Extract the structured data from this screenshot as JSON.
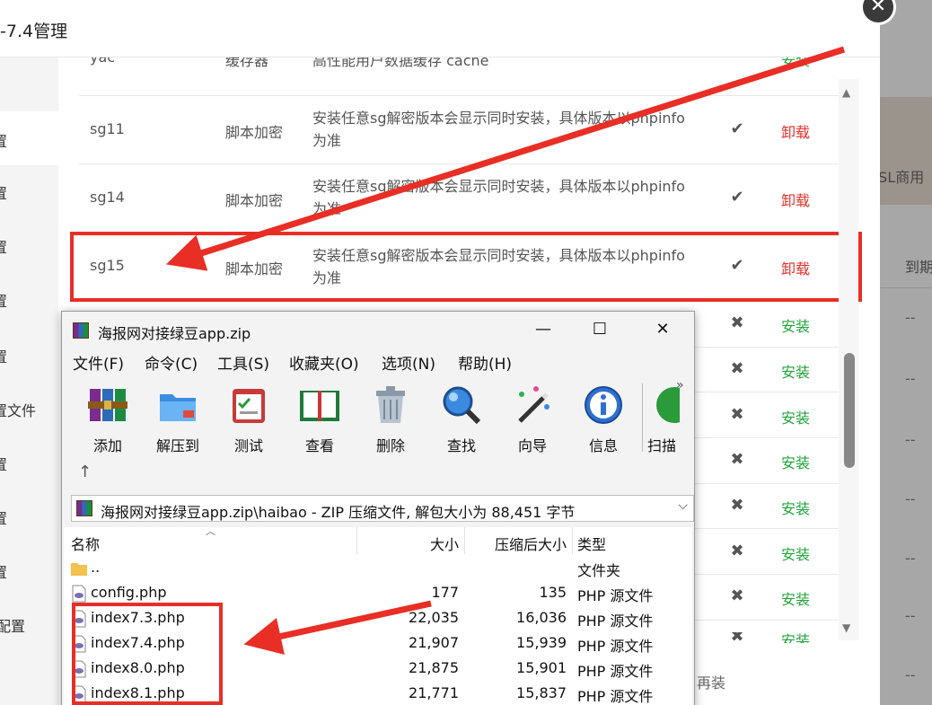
{
  "dialog": {
    "title": "-7.4管理",
    "sidebar": [
      {
        "label": "置"
      },
      {
        "label": "置"
      },
      {
        "label": "置"
      },
      {
        "label": "置"
      },
      {
        "label": "置"
      },
      {
        "label": "置文件"
      },
      {
        "label": "置"
      },
      {
        "label": "置"
      },
      {
        "label": "置"
      },
      {
        "label": "配置"
      }
    ],
    "top_partial_row": {
      "name": "yac",
      "type": "缓存器",
      "desc": "高性能用户数据缓存 cache",
      "action": "安装"
    },
    "rows": [
      {
        "name": "sg11",
        "type": "脚本加密",
        "desc": "安装任意sg解密版本会显示同时安装，具体版本以phpinfo为准",
        "status": "✔",
        "action": "卸载"
      },
      {
        "name": "sg14",
        "type": "脚本加密",
        "desc": "安装任意sg解密版本会显示同时安装，具体版本以phpinfo为准",
        "status": "✔",
        "action": "卸载"
      },
      {
        "name": "sg15",
        "type": "脚本加密",
        "desc": "安装任意sg解密版本会显示同时安装，具体版本以phpinfo为准",
        "status": "✔",
        "action": "卸载"
      }
    ],
    "install_rows": [
      {
        "status": "✖",
        "action": "安装"
      },
      {
        "status": "✖",
        "action": "安装"
      },
      {
        "status": "✖",
        "action": "安装"
      },
      {
        "status": "✖",
        "action": "安装"
      },
      {
        "status": "✖",
        "action": "安装"
      },
      {
        "status": "✖",
        "action": "安装"
      },
      {
        "status": "✖",
        "action": "安装"
      },
      {
        "status": "✖",
        "action": "安装"
      }
    ],
    "footer_note": "再装"
  },
  "background": {
    "ssl_text": "SSL商用",
    "col_header": "到期",
    "dashes": [
      "--",
      "--",
      "--",
      "--",
      "--",
      "--",
      "--",
      "--"
    ]
  },
  "rar": {
    "title": "海报网对接绿豆app.zip",
    "menu": [
      "文件(F)",
      "命令(C)",
      "工具(S)",
      "收藏夹(O)",
      "选项(N)",
      "帮助(H)"
    ],
    "toolbar": [
      {
        "label": "添加",
        "icon": "books-icon"
      },
      {
        "label": "解压到",
        "icon": "folder-icon"
      },
      {
        "label": "测试",
        "icon": "checklist-icon"
      },
      {
        "label": "查看",
        "icon": "book-icon"
      },
      {
        "label": "删除",
        "icon": "trash-icon"
      },
      {
        "label": "查找",
        "icon": "magnifier-icon"
      },
      {
        "label": "向导",
        "icon": "wand-icon"
      },
      {
        "label": "信息",
        "icon": "info-icon"
      },
      {
        "label": "扫描",
        "icon": "scan-icon"
      }
    ],
    "address": "海报网对接绿豆app.zip\\haibao - ZIP 压缩文件, 解包大小为 88,451 字节",
    "columns": {
      "name": "名称",
      "size": "大小",
      "packed": "压缩后大小",
      "type": "类型"
    },
    "files": [
      {
        "name": "..",
        "size": "",
        "packed": "",
        "type": "文件夹",
        "icon": "folder-icon"
      },
      {
        "name": "config.php",
        "size": "177",
        "packed": "135",
        "type": "PHP 源文件",
        "icon": "php-file-icon"
      },
      {
        "name": "index7.3.php",
        "size": "22,035",
        "packed": "16,036",
        "type": "PHP 源文件",
        "icon": "php-file-icon"
      },
      {
        "name": "index7.4.php",
        "size": "21,907",
        "packed": "15,939",
        "type": "PHP 源文件",
        "icon": "php-file-icon"
      },
      {
        "name": "index8.0.php",
        "size": "21,875",
        "packed": "15,901",
        "type": "PHP 源文件",
        "icon": "php-file-icon"
      },
      {
        "name": "index8.1.php",
        "size": "21,771",
        "packed": "15,837",
        "type": "PHP 源文件",
        "icon": "php-file-icon"
      }
    ]
  },
  "colors": {
    "highlight": "#e82e25",
    "install": "#20a53a",
    "uninstall": "#e8312a"
  }
}
